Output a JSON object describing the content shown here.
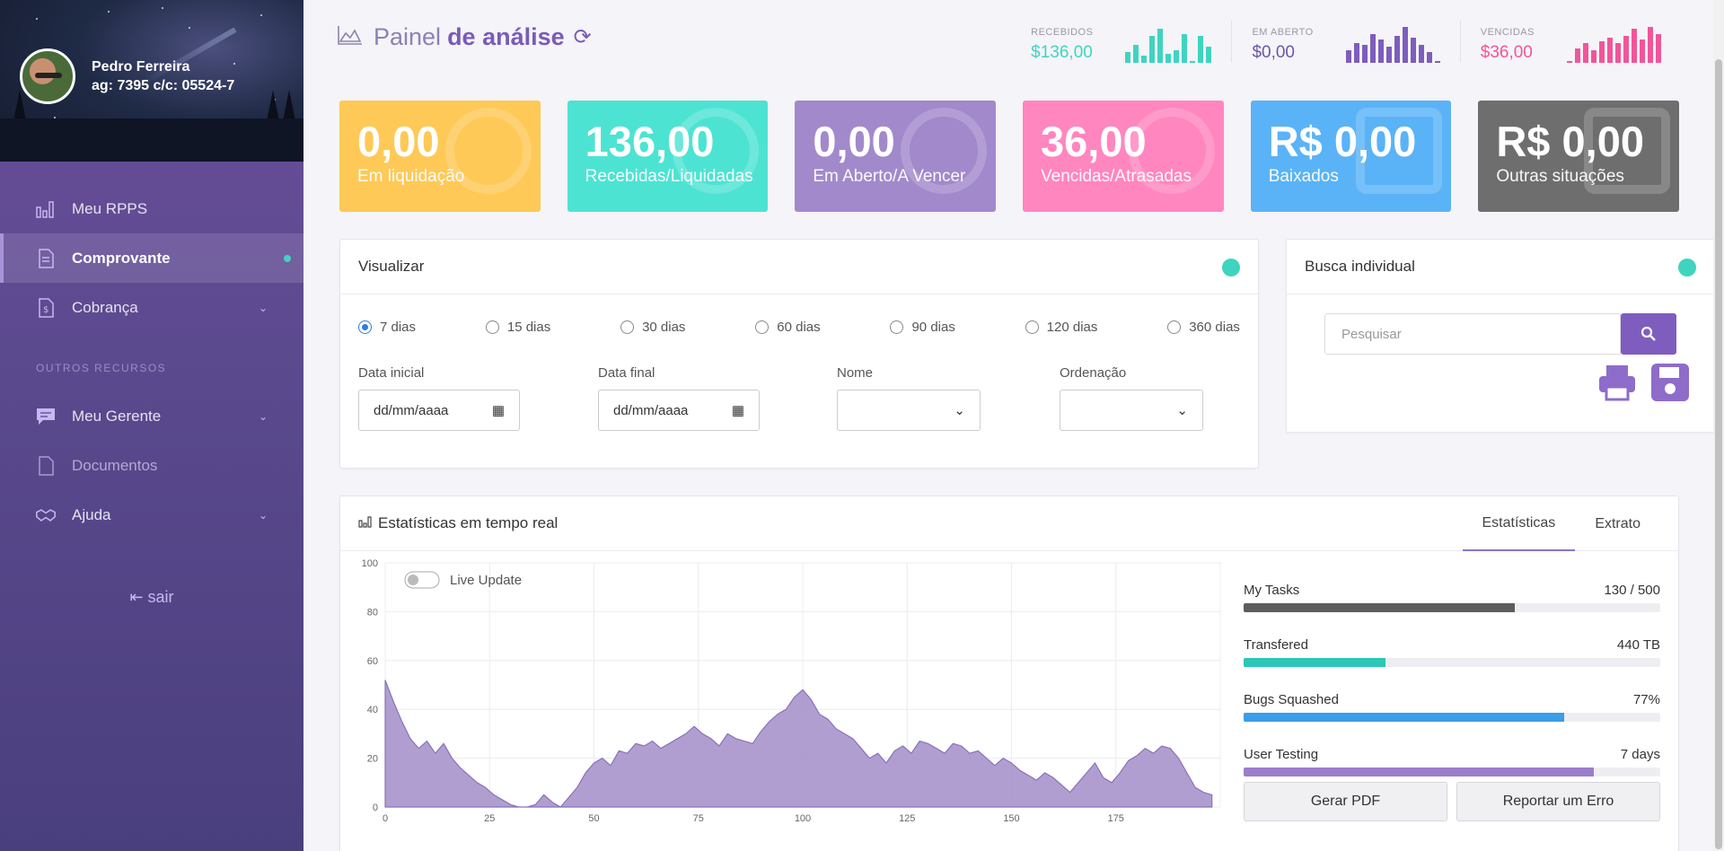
{
  "profile": {
    "name": "Pedro Ferreira",
    "account": "ag: 7395 c/c: 05524-7"
  },
  "sidebar": {
    "items": [
      {
        "label": "Meu RPPS",
        "icon": "bar-chart-icon"
      },
      {
        "label": "Comprovante",
        "icon": "document-icon"
      },
      {
        "label": "Cobrança",
        "icon": "invoice-icon"
      }
    ],
    "section_title": "OUTROS RECURSOS",
    "items2": [
      {
        "label": "Meu Gerente",
        "icon": "chat-icon"
      },
      {
        "label": "Documentos",
        "icon": "file-icon"
      },
      {
        "label": "Ajuda",
        "icon": "handshake-icon"
      }
    ],
    "logout": "sair"
  },
  "header": {
    "title_light": "Painel",
    "title_bold": "de análise"
  },
  "mini_stats": [
    {
      "label": "RECEBIDOS",
      "value": "$136,00",
      "color": "#3fd4c0"
    },
    {
      "label": "EM ABERTO",
      "value": "$0,00",
      "color": "#7e5dbf"
    },
    {
      "label": "VENCIDAS",
      "value": "$36,00",
      "color": "#f2559a"
    }
  ],
  "tiles": [
    {
      "value": "0,00",
      "label": "Em liquidação",
      "color": "#fec956"
    },
    {
      "value": "136,00",
      "label": "Recebidas/Liquidadas",
      "color": "#4de3d2"
    },
    {
      "value": "0,00",
      "label": "Em Aberto/A Vencer",
      "color": "#a289cb"
    },
    {
      "value": "36,00",
      "label": "Vencidas/Atrasadas",
      "color": "#ff86bf"
    },
    {
      "value": "R$ 0,00",
      "label": "Baixados",
      "color": "#5ab3f7"
    },
    {
      "value": "R$ 0,00",
      "label": "Outras situações",
      "color": "#6e6e6e"
    }
  ],
  "visualizar": {
    "title": "Visualizar",
    "ranges": [
      "7 dias",
      "15 dias",
      "30 dias",
      "60 dias",
      "90 dias",
      "120 dias",
      "360 dias"
    ],
    "selected_range": "7 dias",
    "data_inicial_label": "Data inicial",
    "data_inicial_value": "dd/mm/aaaa",
    "data_final_label": "Data final",
    "data_final_value": "dd/mm/aaaa",
    "nome_label": "Nome",
    "ordenacao_label": "Ordenação"
  },
  "busca": {
    "title": "Busca individual",
    "placeholder": "Pesquisar"
  },
  "stats": {
    "title": "Estatísticas em tempo real",
    "tabs": [
      "Estatísticas",
      "Extrato"
    ],
    "live_update": "Live Update",
    "progress": [
      {
        "label": "My Tasks",
        "value": "130 / 500",
        "fraction": 0.65,
        "color": "#5d5d5d"
      },
      {
        "label": "Transfered",
        "value": "440 TB",
        "fraction": 0.34,
        "color": "#2cc7b5"
      },
      {
        "label": "Bugs Squashed",
        "value": "77%",
        "fraction": 0.77,
        "color": "#3a9ee8"
      },
      {
        "label": "User Testing",
        "value": "7 days",
        "fraction": 0.84,
        "color": "#9a7ecb"
      }
    ],
    "buttons": [
      "Gerar PDF",
      "Reportar um Erro"
    ]
  },
  "chart_data": {
    "type": "area",
    "title": "",
    "xlabel": "",
    "ylabel": "",
    "xlim": [
      0,
      200
    ],
    "ylim": [
      0,
      100
    ],
    "xticks": [
      0,
      25,
      50,
      75,
      100,
      125,
      150,
      175
    ],
    "yticks": [
      0,
      20,
      40,
      60,
      80,
      100
    ],
    "grid": true,
    "color": "#a38dc9",
    "x": [
      0,
      2,
      4,
      6,
      8,
      10,
      12,
      14,
      16,
      18,
      20,
      22,
      24,
      26,
      28,
      30,
      32,
      34,
      36,
      38,
      40,
      42,
      44,
      46,
      48,
      50,
      52,
      54,
      56,
      58,
      60,
      62,
      64,
      66,
      68,
      70,
      72,
      74,
      76,
      78,
      80,
      82,
      84,
      86,
      88,
      90,
      92,
      94,
      96,
      98,
      100,
      102,
      104,
      106,
      108,
      110,
      112,
      114,
      116,
      118,
      120,
      122,
      124,
      126,
      128,
      130,
      132,
      134,
      136,
      138,
      140,
      142,
      144,
      146,
      148,
      150,
      152,
      154,
      156,
      158,
      160,
      162,
      164,
      166,
      168,
      170,
      172,
      174,
      176,
      178,
      180,
      182,
      184,
      186,
      188,
      190,
      192,
      194,
      196,
      198
    ],
    "y": [
      52,
      43,
      35,
      28,
      24,
      27,
      22,
      26,
      20,
      16,
      13,
      10,
      8,
      5,
      3,
      1,
      0,
      0,
      1,
      5,
      2,
      0,
      4,
      8,
      14,
      18,
      20,
      17,
      23,
      22,
      26,
      25,
      27,
      24,
      26,
      28,
      30,
      33,
      30,
      28,
      25,
      30,
      28,
      27,
      26,
      31,
      35,
      38,
      40,
      45,
      48,
      44,
      38,
      36,
      32,
      30,
      28,
      24,
      20,
      22,
      18,
      23,
      25,
      22,
      27,
      26,
      24,
      22,
      26,
      25,
      22,
      23,
      20,
      17,
      20,
      18,
      15,
      13,
      11,
      14,
      12,
      9,
      6,
      10,
      14,
      18,
      12,
      10,
      14,
      19,
      21,
      24,
      22,
      25,
      24,
      20,
      14,
      8,
      6,
      5
    ]
  }
}
